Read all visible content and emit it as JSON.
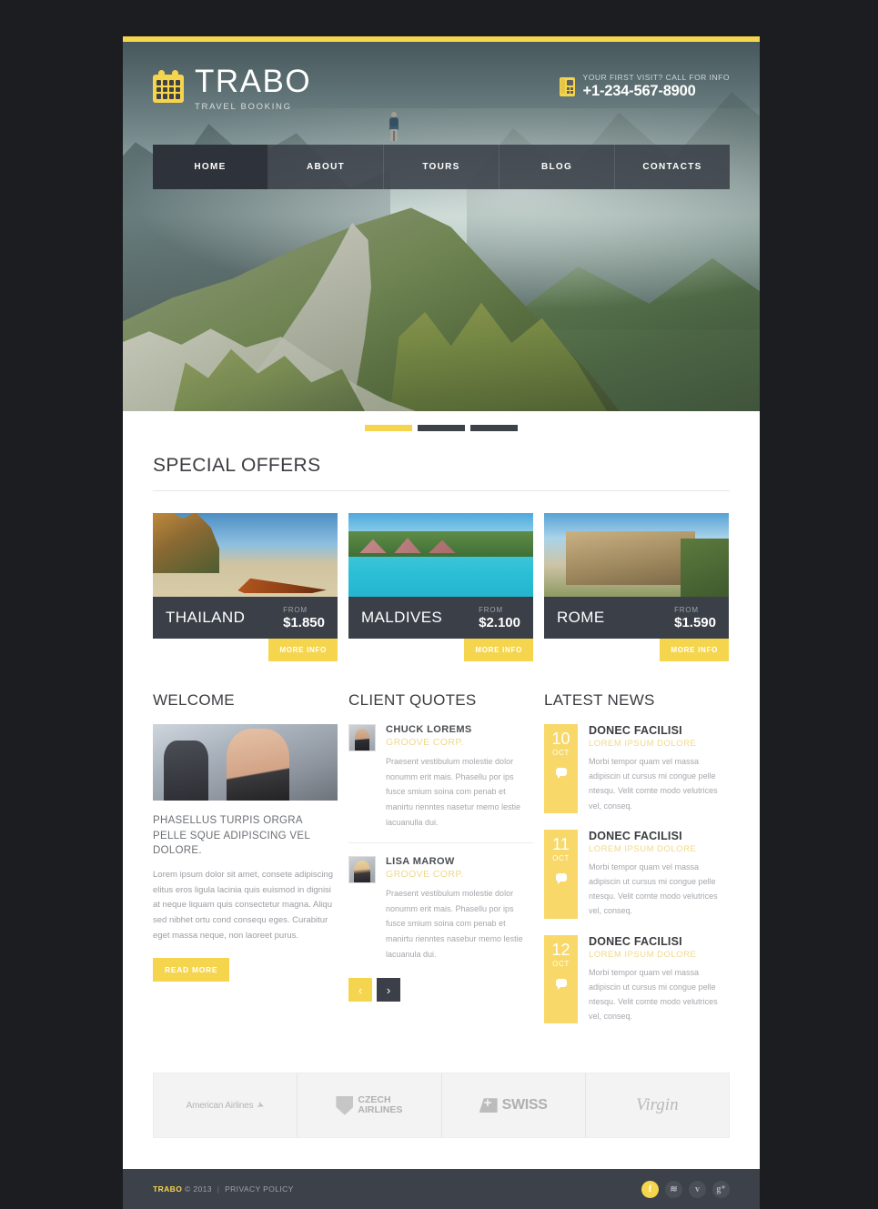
{
  "brand": {
    "name": "TRABO",
    "tagline": "TRAVEL BOOKING",
    "logo_icon": "calendar-icon"
  },
  "contact": {
    "icon": "phone-icon",
    "label": "YOUR FIRST VISIT? CALL FOR INFO",
    "phone": "+1-234-567-8900"
  },
  "nav": {
    "items": [
      {
        "label": "HOME",
        "active": true
      },
      {
        "label": "ABOUT",
        "active": false
      },
      {
        "label": "TOURS",
        "active": false
      },
      {
        "label": "BLOG",
        "active": false
      },
      {
        "label": "CONTACTS",
        "active": false
      }
    ]
  },
  "hero": {
    "description": "hiker-on-mountain-ridge"
  },
  "slider": {
    "slides": [
      {
        "active": true
      },
      {
        "active": false
      },
      {
        "active": false
      }
    ]
  },
  "special_offers": {
    "title": "SPECIAL OFFERS",
    "from_label": "FROM",
    "more_info_label": "MORE INFO",
    "items": [
      {
        "name": "THAILAND",
        "price": "$1.850",
        "image": "thailand-beach-longtail-boat"
      },
      {
        "name": "MALDIVES",
        "price": "$2.100",
        "image": "maldives-bungalows-pier"
      },
      {
        "name": "ROME",
        "price": "$1.590",
        "image": "rome-colosseum"
      }
    ]
  },
  "welcome": {
    "title": "WELCOME",
    "image": "call-center-agent-photo",
    "heading": "PHASELLUS TURPIS ORGRA PELLE SQUE ADIPISCING VEL DOLORE.",
    "body": "Lorem ipsum dolor sit amet, consete adipiscing elitus eros ligula lacinia quis euismod in dignisi at neque liquam quis consectetur magna. Aliqu sed nibhet ortu cond consequ eges. Curabitur eget massa neque, non laoreet purus.",
    "read_more_label": "READ MORE"
  },
  "client_quotes": {
    "title": "CLIENT QUOTES",
    "items": [
      {
        "name": "CHUCK LOREMS",
        "company": "GROOVE CORP.",
        "text": "Praesent vestibulum molestie dolor nonumm erit mais. Phasellu por ips fusce smium soina com penab et manirtu rienntes nasetur memo lestie lacuanulla dui.",
        "avatar": "avatar-male"
      },
      {
        "name": "LISA MAROW",
        "company": "GROOVE CORP.",
        "text": "Praesent vestibulum molestie dolor nonumm erit mais. Phasellu por ips fusce smium soina com penab et manirtu rienntes nasebur memo lestie lacuanula dui.",
        "avatar": "avatar-female"
      }
    ],
    "prev_icon": "chevron-left-icon",
    "next_icon": "chevron-right-icon",
    "prev_label": "‹",
    "next_label": "›"
  },
  "latest_news": {
    "title": "LATEST NEWS",
    "items": [
      {
        "day": "10",
        "month": "OCT",
        "title": "DONEC FACILISI",
        "subtitle": "LOREM IPSUM DOLORE",
        "text": "Morbi tempor quam vel massa adipiscin ut cursus mi congue pelle ntesqu. Velit comte modo velutrices vel, conseq."
      },
      {
        "day": "11",
        "month": "OCT",
        "title": "DONEC FACILISI",
        "subtitle": "LOREM IPSUM DOLORE",
        "text": "Morbi tempor quam vel massa adipiscin ut cursus mi congue pelle ntesqu. Velit comte modo velutrices vel, conseq."
      },
      {
        "day": "12",
        "month": "OCT",
        "title": "DONEC FACILISI",
        "subtitle": "LOREM IPSUM DOLORE",
        "text": "Morbi tempor quam vel massa adipiscin ut cursus mi congue pelle ntesqu. Velit comte modo velutrices vel, conseq."
      }
    ]
  },
  "partners": {
    "items": [
      {
        "name": "American Airlines",
        "icon": "american-airlines-logo"
      },
      {
        "name": "CZECH",
        "name2": "AIRLINES",
        "icon": "czech-airlines-logo"
      },
      {
        "name": "SWISS",
        "icon": "swiss-air-logo"
      },
      {
        "name": "Virgin",
        "icon": "virgin-logo"
      }
    ]
  },
  "footer": {
    "brand": "TRABO",
    "copyright": "© 2013",
    "separator": "|",
    "privacy_label": "PRIVACY POLICY",
    "socials": [
      {
        "name": "facebook",
        "glyph": "f",
        "accent": true
      },
      {
        "name": "rss",
        "glyph": "≋",
        "accent": false
      },
      {
        "name": "twitter",
        "glyph": "ᴠ",
        "accent": false
      },
      {
        "name": "google-plus",
        "glyph": "g⁺",
        "accent": false
      }
    ]
  },
  "colors": {
    "accent": "#f5d54e",
    "dark": "#3b4048",
    "page_bg": "#1c1d21"
  }
}
